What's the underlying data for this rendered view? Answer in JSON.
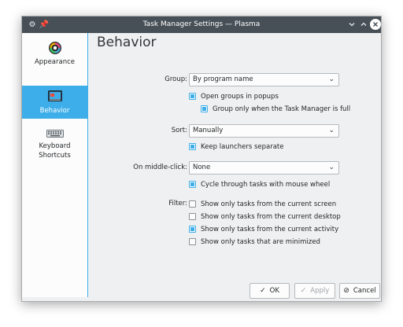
{
  "window": {
    "title": "Task Manager Settings — Plasma"
  },
  "sidebar": {
    "items": [
      {
        "label": "Appearance"
      },
      {
        "label": "Behavior"
      },
      {
        "label": "Keyboard Shortcuts"
      }
    ]
  },
  "page": {
    "title": "Behavior"
  },
  "group": {
    "label": "Group:",
    "value": "By program name",
    "open_popups": {
      "label": "Open groups in popups",
      "checked": true
    },
    "only_full": {
      "label": "Group only when the Task Manager is full",
      "checked": true
    }
  },
  "sort": {
    "label": "Sort:",
    "value": "Manually",
    "keep_launchers": {
      "label": "Keep launchers separate",
      "checked": true
    }
  },
  "middle_click": {
    "label": "On middle-click:",
    "value": "None",
    "cycle_wheel": {
      "label": "Cycle through tasks with mouse wheel",
      "checked": true
    }
  },
  "filter": {
    "label": "Filter:",
    "options": [
      {
        "label": "Show only tasks from the current screen",
        "checked": false
      },
      {
        "label": "Show only tasks from the current desktop",
        "checked": false
      },
      {
        "label": "Show only tasks from the current activity",
        "checked": true
      },
      {
        "label": "Show only tasks that are minimized",
        "checked": false
      }
    ]
  },
  "buttons": {
    "ok": "OK",
    "apply": "Apply",
    "cancel": "Cancel"
  },
  "colors": {
    "accent": "#3daee9",
    "titlebar": "#475057",
    "window_bg": "#eff0f1"
  }
}
